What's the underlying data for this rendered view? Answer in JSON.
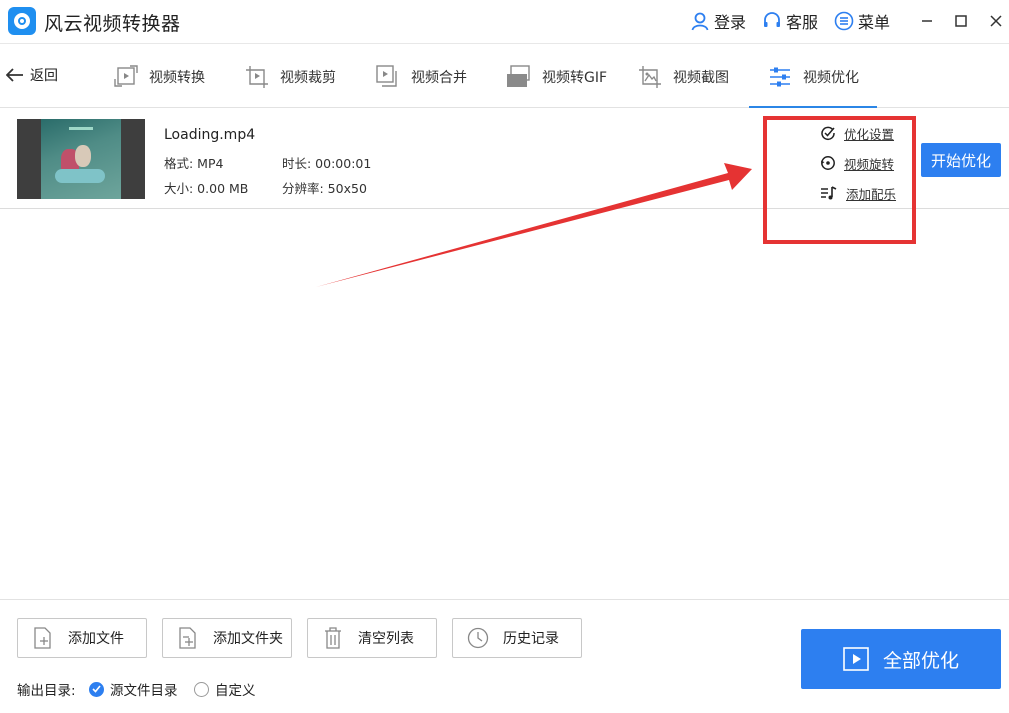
{
  "app": {
    "title": "风云视频转换器",
    "icon": "app-logo-icon"
  },
  "topbar": {
    "login": "登录",
    "service": "客服",
    "menu": "菜单"
  },
  "nav": {
    "back": "返回",
    "tabs": [
      {
        "label": "视频转换",
        "icon": "video-convert-icon"
      },
      {
        "label": "视频裁剪",
        "icon": "video-crop-icon"
      },
      {
        "label": "视频合并",
        "icon": "video-merge-icon"
      },
      {
        "label": "视频转GIF",
        "icon": "gif-icon",
        "badge": "GIF"
      },
      {
        "label": "视频截图",
        "icon": "screenshot-icon"
      },
      {
        "label": "视频优化",
        "icon": "sliders-icon",
        "active": true
      }
    ]
  },
  "file": {
    "name": "Loading.mp4",
    "format_label": "格式: MP4",
    "duration_label": "时长: 00:00:01",
    "size_label": "大小: 0.00 MB",
    "resolution_label": "分辨率: 50x50",
    "options": [
      "优化设置",
      "视频旋转",
      "添加配乐"
    ],
    "start_button": "开始优化"
  },
  "bottom": {
    "buttons": [
      "添加文件",
      "添加文件夹",
      "清空列表",
      "历史记录"
    ],
    "output_label": "输出目录:",
    "radio_source": "源文件目录",
    "radio_custom": "自定义",
    "selected": "源文件目录",
    "all_button": "全部优化"
  },
  "colors": {
    "accent": "#2d7ff0",
    "highlight": "#e53333"
  }
}
